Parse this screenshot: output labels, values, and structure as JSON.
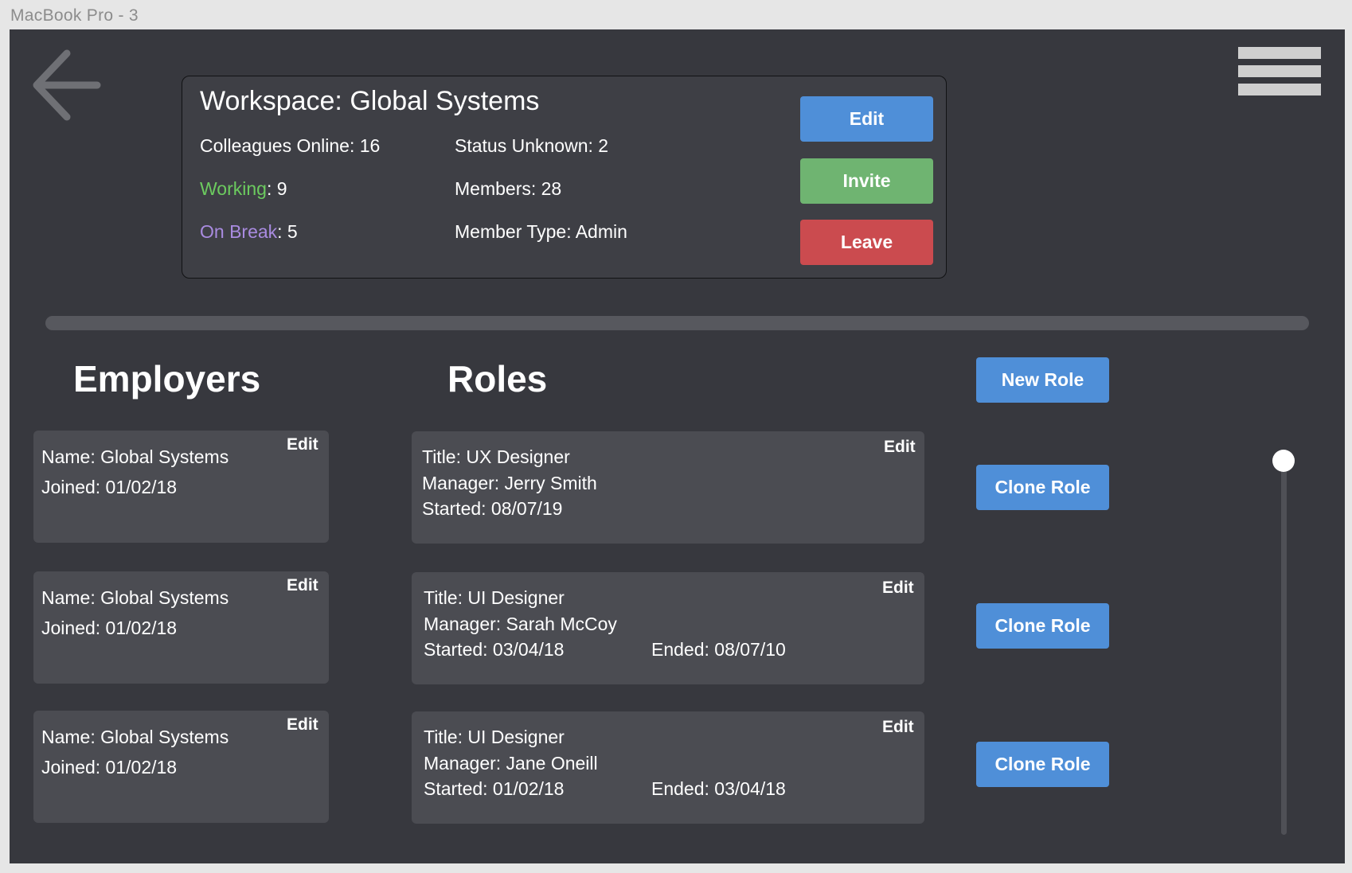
{
  "frame_title": "MacBook Pro - 3",
  "workspace": {
    "title": "Workspace: Global Systems",
    "colleagues_online": "Colleagues Online: 16",
    "working_label": "Working",
    "working_value": ": 9",
    "on_break_label": "On Break",
    "on_break_value": ": 5",
    "status_unknown": "Status Unknown: 2",
    "members": "Members: 28",
    "member_type": "Member Type: Admin",
    "buttons": {
      "edit": "Edit",
      "invite": "Invite",
      "leave": "Leave"
    }
  },
  "employers": {
    "heading": "Employers",
    "items": [
      {
        "name": "Name: Global Systems",
        "joined": "Joined: 01/02/18",
        "edit": "Edit"
      },
      {
        "name": "Name: Global Systems",
        "joined": "Joined: 01/02/18",
        "edit": "Edit"
      },
      {
        "name": "Name: Global Systems",
        "joined": "Joined: 01/02/18",
        "edit": "Edit"
      }
    ]
  },
  "roles": {
    "heading": "Roles",
    "new_role": "New Role",
    "clone_label": "Clone Role",
    "items": [
      {
        "title": "Title: UX Designer",
        "manager": "Manager: Jerry Smith",
        "started": "Started: 08/07/19",
        "ended": "",
        "edit": "Edit"
      },
      {
        "title": "Title: UI Designer",
        "manager": "Manager: Sarah McCoy",
        "started": "Started: 03/04/18",
        "ended": "Ended: 08/07/10",
        "edit": "Edit"
      },
      {
        "title": "Title: UI Designer",
        "manager": "Manager: Jane Oneill",
        "started": "Started: 01/02/18",
        "ended": "Ended: 03/04/18",
        "edit": "Edit"
      }
    ]
  },
  "icons": {
    "back": "arrow-left-icon",
    "menu": "hamburger-menu-icon"
  },
  "colors": {
    "background": "#37383e",
    "card": "#4b4c52",
    "blue": "#4f8fd8",
    "green": "#6fb471",
    "red": "#cb4b4f",
    "working": "#6ccb5f",
    "on_break": "#a98be0"
  }
}
